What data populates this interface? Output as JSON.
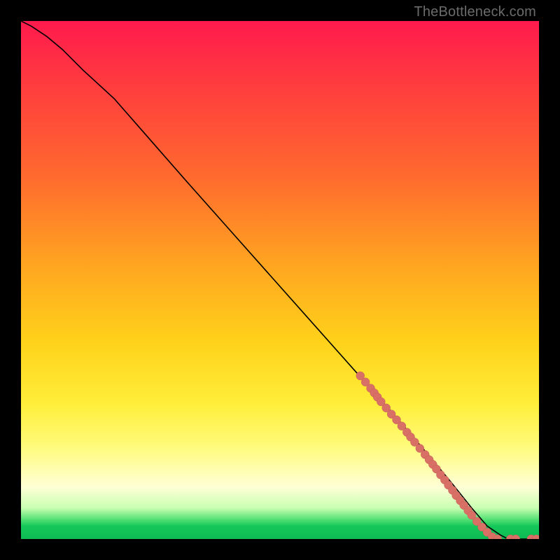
{
  "watermark": "TheBottleneck.com",
  "chart_data": {
    "type": "line",
    "title": "",
    "xlabel": "",
    "ylabel": "",
    "xlim": [
      0,
      100
    ],
    "ylim": [
      0,
      100
    ],
    "grid": false,
    "legend": false,
    "background": "red-orange-yellow-green vertical gradient",
    "series": [
      {
        "name": "curve",
        "x": [
          0,
          2,
          5,
          8,
          12,
          18,
          25,
          32,
          40,
          48,
          56,
          64,
          72,
          78,
          83,
          87,
          90,
          92.5,
          94,
          96,
          98,
          100
        ],
        "y": [
          100,
          99,
          97,
          94.5,
          90.5,
          85,
          77,
          69,
          60,
          51,
          42,
          33,
          24,
          17,
          11,
          6,
          2.5,
          0.8,
          0,
          0,
          0,
          0
        ]
      }
    ],
    "markers": [
      {
        "x": 65.5,
        "y": 31.5,
        "r": 6
      },
      {
        "x": 66.5,
        "y": 30.3,
        "r": 6
      },
      {
        "x": 67.5,
        "y": 29.1,
        "r": 6
      },
      {
        "x": 68.2,
        "y": 28.2,
        "r": 6
      },
      {
        "x": 68.8,
        "y": 27.4,
        "r": 6
      },
      {
        "x": 69.5,
        "y": 26.5,
        "r": 6
      },
      {
        "x": 70.5,
        "y": 25.3,
        "r": 6
      },
      {
        "x": 71.5,
        "y": 24.1,
        "r": 6
      },
      {
        "x": 72.5,
        "y": 23.0,
        "r": 6
      },
      {
        "x": 73.5,
        "y": 21.8,
        "r": 6
      },
      {
        "x": 74.5,
        "y": 20.6,
        "r": 6
      },
      {
        "x": 75.2,
        "y": 19.7,
        "r": 6
      },
      {
        "x": 76.0,
        "y": 18.7,
        "r": 6
      },
      {
        "x": 77.0,
        "y": 17.5,
        "r": 6
      },
      {
        "x": 78.0,
        "y": 16.3,
        "r": 6
      },
      {
        "x": 78.8,
        "y": 15.3,
        "r": 6
      },
      {
        "x": 79.5,
        "y": 14.4,
        "r": 6
      },
      {
        "x": 80.2,
        "y": 13.5,
        "r": 6
      },
      {
        "x": 81.0,
        "y": 12.4,
        "r": 6
      },
      {
        "x": 81.8,
        "y": 11.4,
        "r": 6
      },
      {
        "x": 82.5,
        "y": 10.4,
        "r": 6
      },
      {
        "x": 83.3,
        "y": 9.4,
        "r": 6
      },
      {
        "x": 84.0,
        "y": 8.4,
        "r": 6
      },
      {
        "x": 84.8,
        "y": 7.4,
        "r": 6
      },
      {
        "x": 85.5,
        "y": 6.5,
        "r": 6
      },
      {
        "x": 86.3,
        "y": 5.5,
        "r": 6
      },
      {
        "x": 87.0,
        "y": 4.6,
        "r": 6
      },
      {
        "x": 88.0,
        "y": 3.4,
        "r": 6
      },
      {
        "x": 89.0,
        "y": 2.3,
        "r": 6
      },
      {
        "x": 90.0,
        "y": 1.3,
        "r": 6
      },
      {
        "x": 91.0,
        "y": 0.4,
        "r": 6
      },
      {
        "x": 92.0,
        "y": 0.0,
        "r": 6
      },
      {
        "x": 94.5,
        "y": 0.0,
        "r": 6
      },
      {
        "x": 95.5,
        "y": 0.0,
        "r": 6
      },
      {
        "x": 98.5,
        "y": 0.0,
        "r": 6
      },
      {
        "x": 99.5,
        "y": 0.0,
        "r": 6
      }
    ]
  }
}
